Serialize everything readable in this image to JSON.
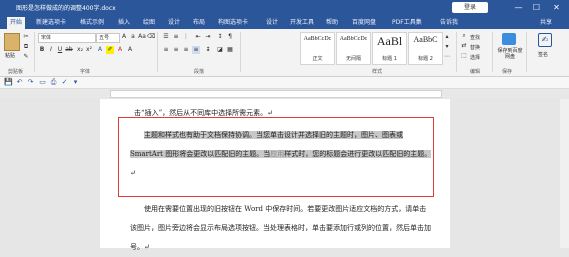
{
  "app": {
    "title": "图形是怎样做成的的调整400字.docx",
    "user_button": "登录",
    "win_controls": [
      "—",
      "☐",
      "✕"
    ]
  },
  "tabs": [
    "开始",
    "新建选项卡",
    "格式示例",
    "插入",
    "绘图",
    "设计",
    "布局",
    "构图选项卡",
    "设计",
    "开发工具",
    "帮助",
    "百度网盘",
    "PDF工具集",
    "告诉我",
    "共享"
  ],
  "ribbon": {
    "clipboard": {
      "paste": "粘贴",
      "group": "剪贴板"
    },
    "font": {
      "name": "宋体",
      "size": "五号",
      "group": "字体"
    },
    "paragraph": {
      "group": "段落"
    },
    "styles": {
      "items": [
        {
          "sample": "AaBbCcDc",
          "name": "正文"
        },
        {
          "sample": "AaBbCcDc",
          "name": "无间隔"
        },
        {
          "sample": "AaBl",
          "name": "标题 1"
        },
        {
          "sample": "AaBbC",
          "name": "标题 2"
        }
      ],
      "group": "样式"
    },
    "editing": {
      "find": "查找",
      "replace": "替换",
      "select": "选择",
      "group": "编辑"
    },
    "save": {
      "label": "保存到百度网盘",
      "group": "保存"
    },
    "sign": {
      "label": "签名"
    }
  },
  "document": {
    "line1": "击“插入”，然后从不同库中选择所需元素。↵",
    "para2": {
      "seg1": "主题和样式也有助于文档保持协调。当您单击设计并选择旧的主题时，图片、图表或 SmartArt 图形将会更改以匹配旧的主题。当",
      "seg2": "应用",
      "seg3": "样式时，您的标题会进行更改以匹配旧的主题。",
      "end": "↵"
    },
    "para3": "使用在需要位置出现的旧按钮在 Word 中保存时间。若要更改图片适应文档的方式，请单击该图片，图片旁边将会显示布局选项按钮。当处理表格时，单击要添加行或列的位置，然后单击加号。↵"
  }
}
